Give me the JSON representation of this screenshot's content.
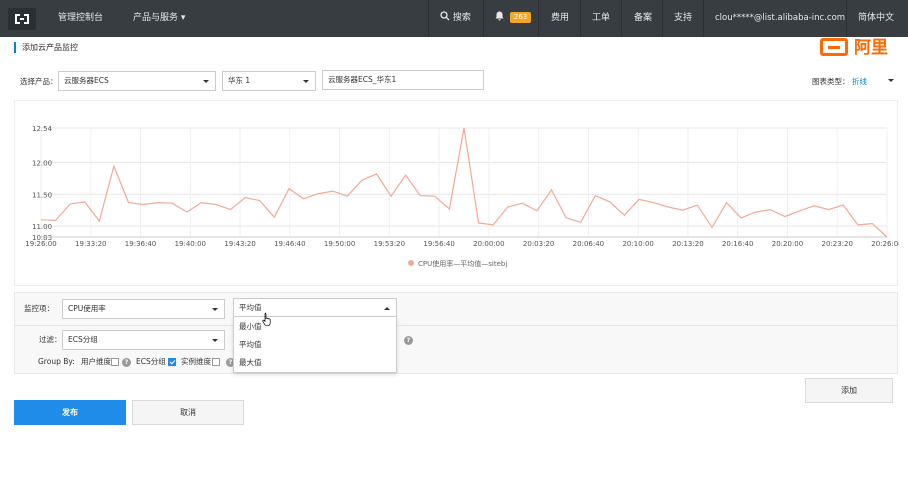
{
  "topbar": {
    "console": "管理控制台",
    "products": "产品与服务 ▾",
    "search": "搜索",
    "badge": "263",
    "billing": "费用",
    "ticket": "工单",
    "record": "备案",
    "support": "支持",
    "user": "clou*****@list.alibaba-inc.com",
    "lang": "简体中文"
  },
  "brand": {
    "text": "阿里"
  },
  "page": {
    "title": "添加云产品监控"
  },
  "filter": {
    "product_label": "选择产品：",
    "product_value": "云服务器ECS",
    "region_value": "华东 1",
    "instance_value": "云服务器ECS_华东1",
    "chart_type_label": "图表类型：",
    "chart_type_value": "折线"
  },
  "chart_data": {
    "type": "line",
    "ylim": [
      10.83,
      12.54
    ],
    "y_ticks": [
      "12.54",
      "12.00",
      "11.50",
      "11.00",
      "10.83"
    ],
    "y_tick_values": [
      12.54,
      12.0,
      11.5,
      11.0,
      10.83
    ],
    "x_tick_labels": [
      "19:26:00",
      "19:33:20",
      "19:36:40",
      "19:40:00",
      "19:43:20",
      "19:46:40",
      "19:50:00",
      "19:53:20",
      "19:56:40",
      "20:00:00",
      "20:03:20",
      "20:06:40",
      "20:10:00",
      "20:13:20",
      "20:16:40",
      "20:20:00",
      "20:23:20",
      "20:26:00"
    ],
    "series": [
      {
        "name": "CPU使用率—平均值—sitebj",
        "color": "#f2a995",
        "values": [
          11.1,
          11.09,
          11.35,
          11.38,
          11.08,
          11.94,
          11.37,
          11.34,
          11.37,
          11.36,
          11.22,
          11.37,
          11.34,
          11.26,
          11.45,
          11.4,
          11.14,
          11.59,
          11.43,
          11.51,
          11.55,
          11.47,
          11.72,
          11.82,
          11.47,
          11.8,
          11.48,
          11.47,
          11.27,
          12.54,
          11.05,
          11.02,
          11.3,
          11.36,
          11.24,
          11.57,
          11.13,
          11.06,
          11.48,
          11.38,
          11.17,
          11.42,
          11.37,
          11.3,
          11.25,
          11.33,
          10.98,
          11.37,
          11.13,
          11.22,
          11.26,
          11.15,
          11.24,
          11.32,
          11.26,
          11.33,
          11.02,
          11.04,
          10.83
        ]
      }
    ]
  },
  "config": {
    "metric_label": "监控项：",
    "metric_value": "CPU使用率",
    "stat_value": "平均值",
    "stat_options": [
      "最小值",
      "平均值",
      "最大值"
    ],
    "filter_label": "过滤：",
    "filter_value": "ECS分组",
    "groupby_label": "Group By:",
    "groupby_user": "用户维度",
    "groupby_ecs": "ECS分组",
    "groupby_instance": "实例维度",
    "help": "?"
  },
  "actions": {
    "add": "添加",
    "publish": "发布",
    "cancel": "取消"
  }
}
